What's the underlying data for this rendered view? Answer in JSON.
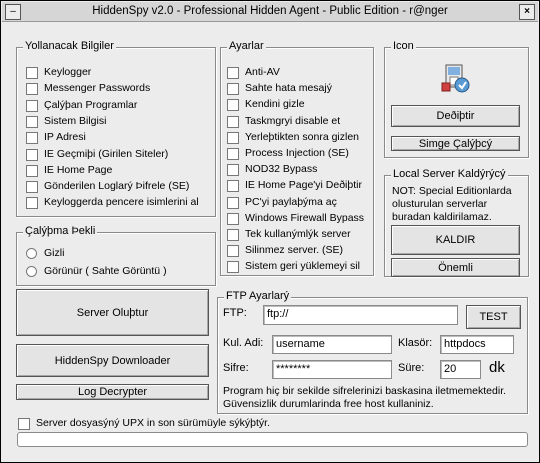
{
  "window": {
    "title": "HiddenSpy v2.0 - Professional Hidden Agent - Public Edition - r@nger",
    "min_symbol": "–",
    "close_symbol": "×"
  },
  "info_group": {
    "legend": "Yollanacak Bilgiler",
    "items": [
      {
        "label": "Keylogger",
        "checked": false
      },
      {
        "label": "Messenger Passwords",
        "checked": false
      },
      {
        "label": "Çalýþan Programlar",
        "checked": false
      },
      {
        "label": "Sistem Bilgisi",
        "checked": false
      },
      {
        "label": "IP Adresi",
        "checked": false
      },
      {
        "label": "IE Geçmiþi (Girilen Siteler)",
        "checked": false
      },
      {
        "label": "IE Home Page",
        "checked": false
      },
      {
        "label": "Gönderilen Loglarý Þifrele (SE)",
        "checked": false
      },
      {
        "label": "Keyloggerda pencere isimlerini al",
        "checked": false
      }
    ]
  },
  "mode_group": {
    "legend": "Çalýþma Þekli",
    "options": [
      {
        "label": "Gizli",
        "selected": false
      },
      {
        "label": "Görünür ( Sahte Görüntü )",
        "selected": false
      }
    ]
  },
  "settings_group": {
    "legend": "Ayarlar",
    "items": [
      {
        "label": "Anti-AV",
        "checked": false
      },
      {
        "label": "Sahte hata mesajý",
        "checked": false
      },
      {
        "label": "Kendini gizle",
        "checked": false
      },
      {
        "label": "Taskmgryi disable et",
        "checked": false
      },
      {
        "label": "Yerleþtikten sonra gizlen",
        "checked": false
      },
      {
        "label": "Process Injection (SE)",
        "checked": false
      },
      {
        "label": "NOD32 Bypass",
        "checked": false
      },
      {
        "label": "IE Home Page'yi Deðiþtir",
        "checked": false
      },
      {
        "label": "PC'yi paylaþýma aç",
        "checked": false
      },
      {
        "label": "Windows Firewall Bypass",
        "checked": false
      },
      {
        "label": "Tek kullanýmlýk server",
        "checked": false
      },
      {
        "label": "Silinmez server. (SE)",
        "checked": false
      },
      {
        "label": "Sistem geri yüklemeyi sil",
        "checked": false
      }
    ]
  },
  "icon_group": {
    "legend": "Icon",
    "change_button": "Deðiþtir",
    "simulate_button": "Simge Çalýþcý"
  },
  "remover_group": {
    "legend": "Local Server Kaldýrýcý",
    "note": "NOT: Special Editionlarda olusturulan serverlar buradan kaldirilamaz.",
    "remove_button": "KALDIR",
    "important_button": "Önemli"
  },
  "buttons": {
    "create_server": "Server Oluþtur",
    "downloader": "HiddenSpy Downloader",
    "log_decrypter": "Log Decrypter"
  },
  "ftp_group": {
    "legend": "FTP Ayarlarý",
    "ftp_label": "FTP:",
    "ftp_value": "ftp://",
    "test_button": "TEST",
    "user_label": "Kul. Adi:",
    "user_value": "username",
    "folder_label": "Klasör:",
    "folder_value": "httpdocs",
    "pass_label": "Sifre:",
    "pass_value": "********",
    "time_label": "Süre:",
    "time_value": "20",
    "time_unit": "dk",
    "warning": "Program hiç bir sekilde sifrelerinizi baskasina iletmemektedir. Güvensizlik durumlarinda free host kullaniniz."
  },
  "upx": {
    "label": "Server dosyasýný UPX in son sürümüyle sýkýþtýr.",
    "checked": false
  },
  "progress": {
    "value": 0
  }
}
